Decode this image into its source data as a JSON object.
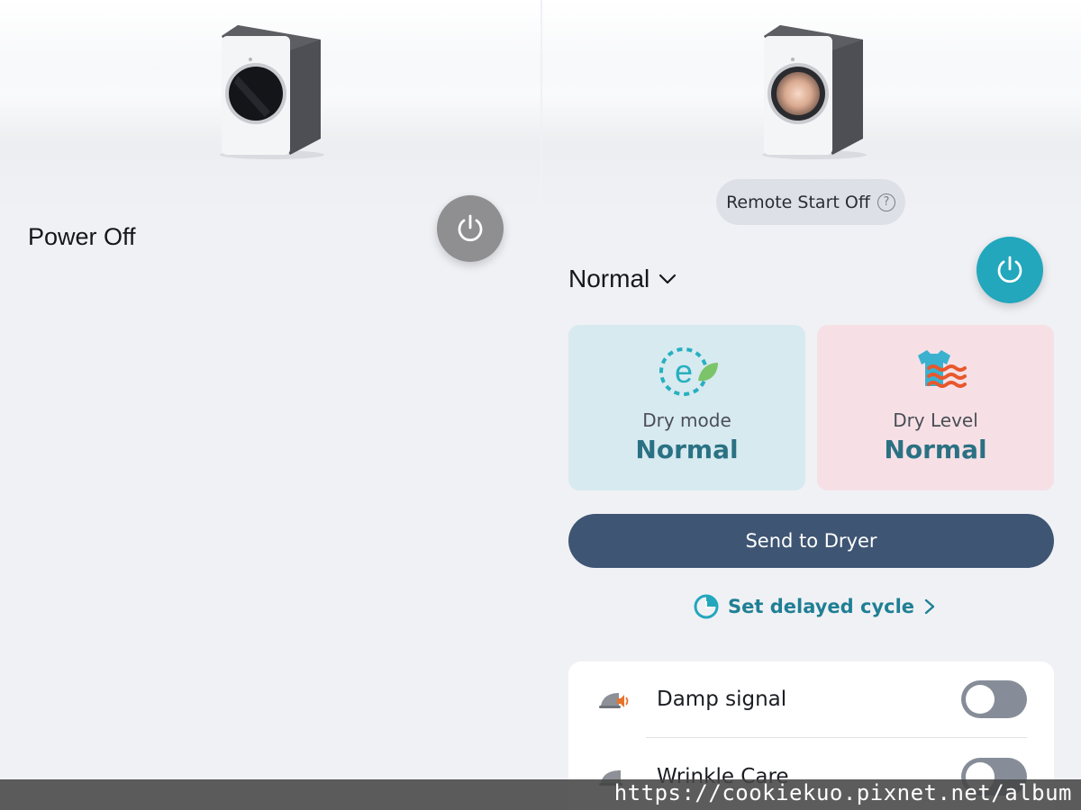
{
  "left_panel": {
    "status_text": "Power Off"
  },
  "right_panel": {
    "remote_start_label": "Remote Start Off",
    "remote_start_help": "?",
    "course_selected": "Normal",
    "dry_mode": {
      "label": "Dry mode",
      "value": "Normal"
    },
    "dry_level": {
      "label": "Dry Level",
      "value": "Normal"
    },
    "send_button_label": "Send to Dryer",
    "delayed_cycle_label": "Set delayed cycle",
    "settings": [
      {
        "label": "Damp signal",
        "icon": "iron-speaker-icon",
        "enabled": false
      },
      {
        "label": "Wrinkle Care",
        "icon": "iron-icon",
        "enabled": false
      }
    ]
  },
  "watermark": "https://cookiekuo.pixnet.net/album",
  "colors": {
    "accent_teal": "#22a7bd",
    "power_off_gray": "#8f8f92",
    "send_button_navy": "#3e5573",
    "dry_mode_card": "#d7eaf0",
    "dry_level_card": "#f6e0e6",
    "value_teal": "#2a7183"
  }
}
